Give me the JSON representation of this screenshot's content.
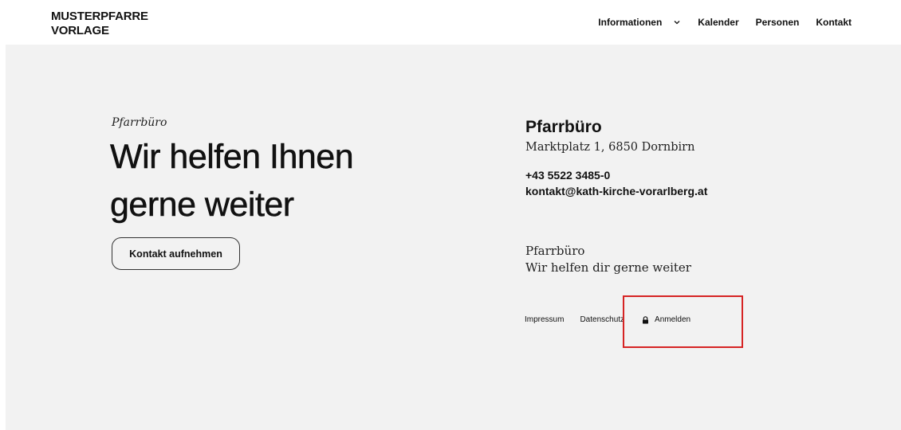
{
  "header": {
    "logo_line1": "MUSTERPFARRE",
    "logo_line2": "VORLAGE",
    "nav": [
      {
        "label": "Informationen",
        "has_dropdown": true
      },
      {
        "label": "Kalender"
      },
      {
        "label": "Personen"
      },
      {
        "label": "Kontakt"
      }
    ]
  },
  "hero": {
    "kicker": "Pfarrbüro",
    "headline_line1": "Wir helfen Ihnen",
    "headline_line2": "gerne weiter",
    "cta_label": "Kontakt aufnehmen"
  },
  "contact": {
    "title": "Pfarrbüro",
    "address": "Marktplatz 1, 6850 Dornbirn",
    "phone": "+43 5522 3485-0",
    "email": "kontakt@kath-kirche-vorarlberg.at",
    "sub_line1": "Pfarrbüro",
    "sub_line2": "Wir helfen dir gerne weiter"
  },
  "footer": {
    "impressum": "Impressum",
    "datenschutz": "Datenschutz",
    "login": "Anmelden",
    "login_icon": "lock-icon"
  },
  "colors": {
    "background": "#f2f2f2",
    "header": "#ffffff",
    "text": "#111111",
    "highlight": "#d62424"
  }
}
